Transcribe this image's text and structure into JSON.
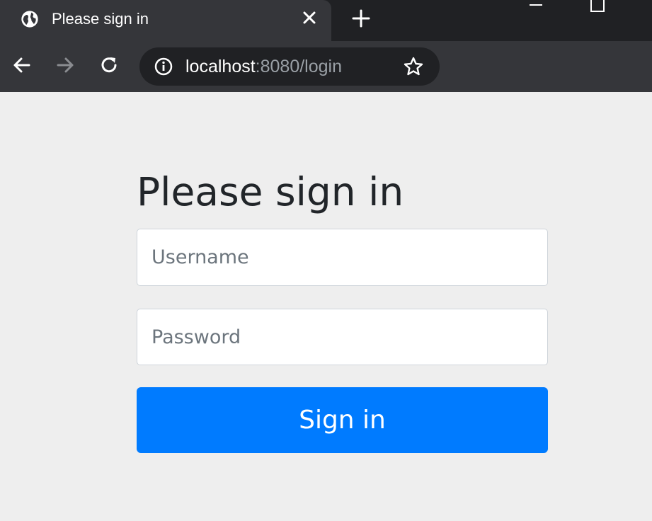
{
  "browser": {
    "tab_title": "Please sign in",
    "url_host": "localhost",
    "url_rest": ":8080/login",
    "icons": {
      "favicon": "globe-icon",
      "tab_close": "close-icon",
      "new_tab": "plus-icon",
      "back": "arrow-left-icon",
      "forward": "arrow-right-icon",
      "reload": "reload-icon",
      "site_info": "info-icon",
      "bookmark": "star-icon",
      "minimize": "minimize-icon",
      "maximize": "maximize-icon"
    },
    "colors": {
      "tabstrip": "#202124",
      "toolbar": "#35363a",
      "omnibox": "#202124",
      "url_secondary": "#9aa0a6"
    }
  },
  "login": {
    "heading": "Please sign in",
    "username_placeholder": "Username",
    "password_placeholder": "Password",
    "submit_label": "Sign in",
    "colors": {
      "page_bg": "#eeeeee",
      "heading": "#212529",
      "button": "#007bff",
      "button_text": "#ffffff"
    }
  }
}
